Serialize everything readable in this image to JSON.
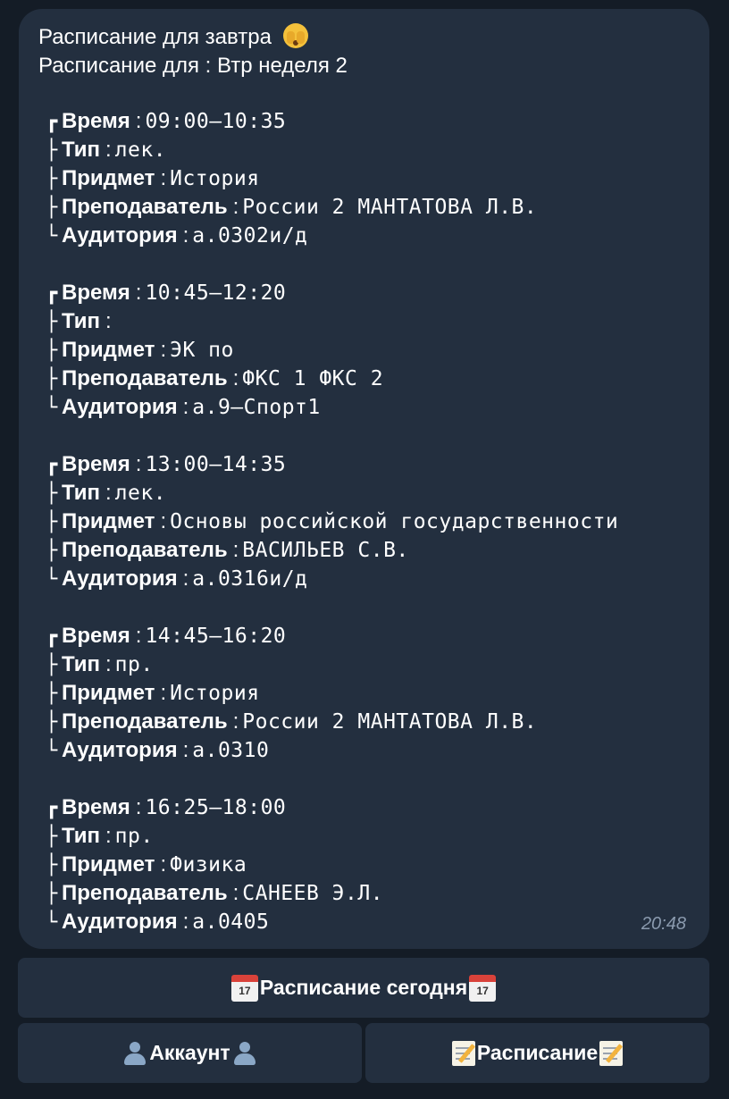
{
  "message": {
    "title": "Расписание для завтра",
    "title_emoji": "face-with-hand-over-mouth-icon",
    "subtitle": "Расписание для : Втр неделя 2",
    "time": "20:48",
    "lessons": [
      {
        "time_label": "Время",
        "time": "09:00–10:35",
        "type_label": "Тип",
        "type": "лек.",
        "subject_label": "Придмет",
        "subject": "История",
        "teacher_label": "Преподаватель",
        "teacher": "России 2 МАНТАТОВА Л.В.",
        "room_label": "Аудитория",
        "room": "а.0302и/д"
      },
      {
        "time_label": "Время",
        "time": "10:45–12:20",
        "type_label": "Тип",
        "type": "",
        "subject_label": "Придмет",
        "subject": "ЭК по",
        "teacher_label": "Преподаватель",
        "teacher": "ФКС 1 ФКС 2",
        "room_label": "Аудитория",
        "room": "а.9–Спорт1"
      },
      {
        "time_label": "Время",
        "time": "13:00–14:35",
        "type_label": "Тип",
        "type": "лек.",
        "subject_label": "Придмет",
        "subject": "Основы российской государственности",
        "teacher_label": "Преподаватель",
        "teacher": "ВАСИЛЬЕВ С.В.",
        "room_label": "Аудитория",
        "room": "а.0316и/д"
      },
      {
        "time_label": "Время",
        "time": "14:45–16:20",
        "type_label": "Тип",
        "type": "пр.",
        "subject_label": "Придмет",
        "subject": "История",
        "teacher_label": "Преподаватель",
        "teacher": "России 2 МАНТАТОВА Л.В.",
        "room_label": "Аудитория",
        "room": "а.0310"
      },
      {
        "time_label": "Время",
        "time": "16:25–18:00",
        "type_label": "Тип",
        "type": "пр.",
        "subject_label": "Придмет",
        "subject": "Физика",
        "teacher_label": "Преподаватель",
        "teacher": "САНЕЕВ Э.Л.",
        "room_label": "Аудитория",
        "room": "а.0405"
      }
    ]
  },
  "keyboard": {
    "today_label": "Расписание сегодня",
    "today_icon": "calendar-icon",
    "account_label": "Аккаунт",
    "account_icon": "person-silhouette-icon",
    "schedule_label": "Расписание",
    "schedule_icon": "memo-icon",
    "calendar_day": "17"
  },
  "colors": {
    "background": "#141c26",
    "bubble": "#232f3f",
    "time_text": "#8a9aae"
  }
}
